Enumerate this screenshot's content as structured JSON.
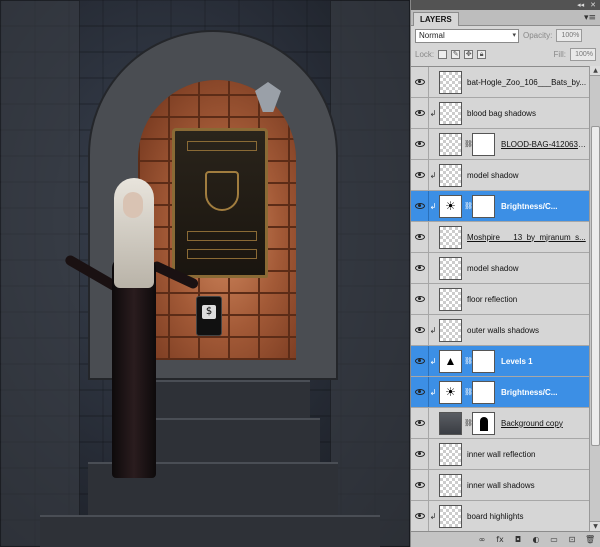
{
  "panel": {
    "collapse_glyph": "◂◂",
    "close_glyph": "✕",
    "tab_label": "LAYERS",
    "menu_glyph": "▾≡",
    "blend_mode": "Normal",
    "opacity_label": "Opacity:",
    "opacity_value": "100%",
    "lock_label": "Lock:",
    "fill_label": "Fill:",
    "fill_value": "100%"
  },
  "layers": [
    {
      "name": "bat-Hogle_Zoo_106___Bats_by...",
      "selected": false,
      "clip": false,
      "thumb": "transparent",
      "mask": false
    },
    {
      "name": "blood bag shadows",
      "selected": false,
      "clip": true,
      "thumb": "transparent",
      "mask": false
    },
    {
      "name": "BLOOD-BAG-4120638....",
      "selected": false,
      "clip": false,
      "thumb": "transparent",
      "mask": true,
      "underline": true
    },
    {
      "name": "model shadow",
      "selected": false,
      "clip": true,
      "thumb": "transparent",
      "mask": false
    },
    {
      "name": "Brightness/C...",
      "selected": true,
      "clip": true,
      "thumb": "brightness",
      "mask": true,
      "bold": true
    },
    {
      "name": "Moshpire___13_by_mjranum_s...",
      "selected": false,
      "clip": false,
      "thumb": "transparent",
      "mask": false,
      "underline": true
    },
    {
      "name": "model shadow",
      "selected": false,
      "clip": false,
      "thumb": "transparent",
      "mask": false
    },
    {
      "name": "floor reflection",
      "selected": false,
      "clip": false,
      "thumb": "transparent",
      "mask": false
    },
    {
      "name": "outer walls shadows",
      "selected": false,
      "clip": true,
      "thumb": "transparent",
      "mask": false
    },
    {
      "name": "Levels 1",
      "selected": true,
      "clip": true,
      "thumb": "levels",
      "mask": true,
      "bold": true
    },
    {
      "name": "Brightness/C...",
      "selected": true,
      "clip": true,
      "thumb": "brightness",
      "mask": true,
      "bold": true
    },
    {
      "name": "Background copy",
      "selected": false,
      "clip": false,
      "thumb": "photo",
      "mask": true,
      "mask_door": true,
      "underline": true
    },
    {
      "name": "inner wall reflection",
      "selected": false,
      "clip": false,
      "thumb": "transparent",
      "mask": false
    },
    {
      "name": "inner wall shadows",
      "selected": false,
      "clip": false,
      "thumb": "transparent",
      "mask": false
    },
    {
      "name": "board highlights",
      "selected": false,
      "clip": true,
      "thumb": "transparent",
      "mask": false
    }
  ],
  "icons": {
    "brightness": "☀",
    "levels": "▲",
    "clip": "↲",
    "chain": "⛓"
  },
  "bottom_bar": [
    "∞",
    "fx",
    "◘",
    "◐",
    "▭",
    "⊡",
    "🗑"
  ],
  "canvas": {
    "bag_label": "$"
  }
}
